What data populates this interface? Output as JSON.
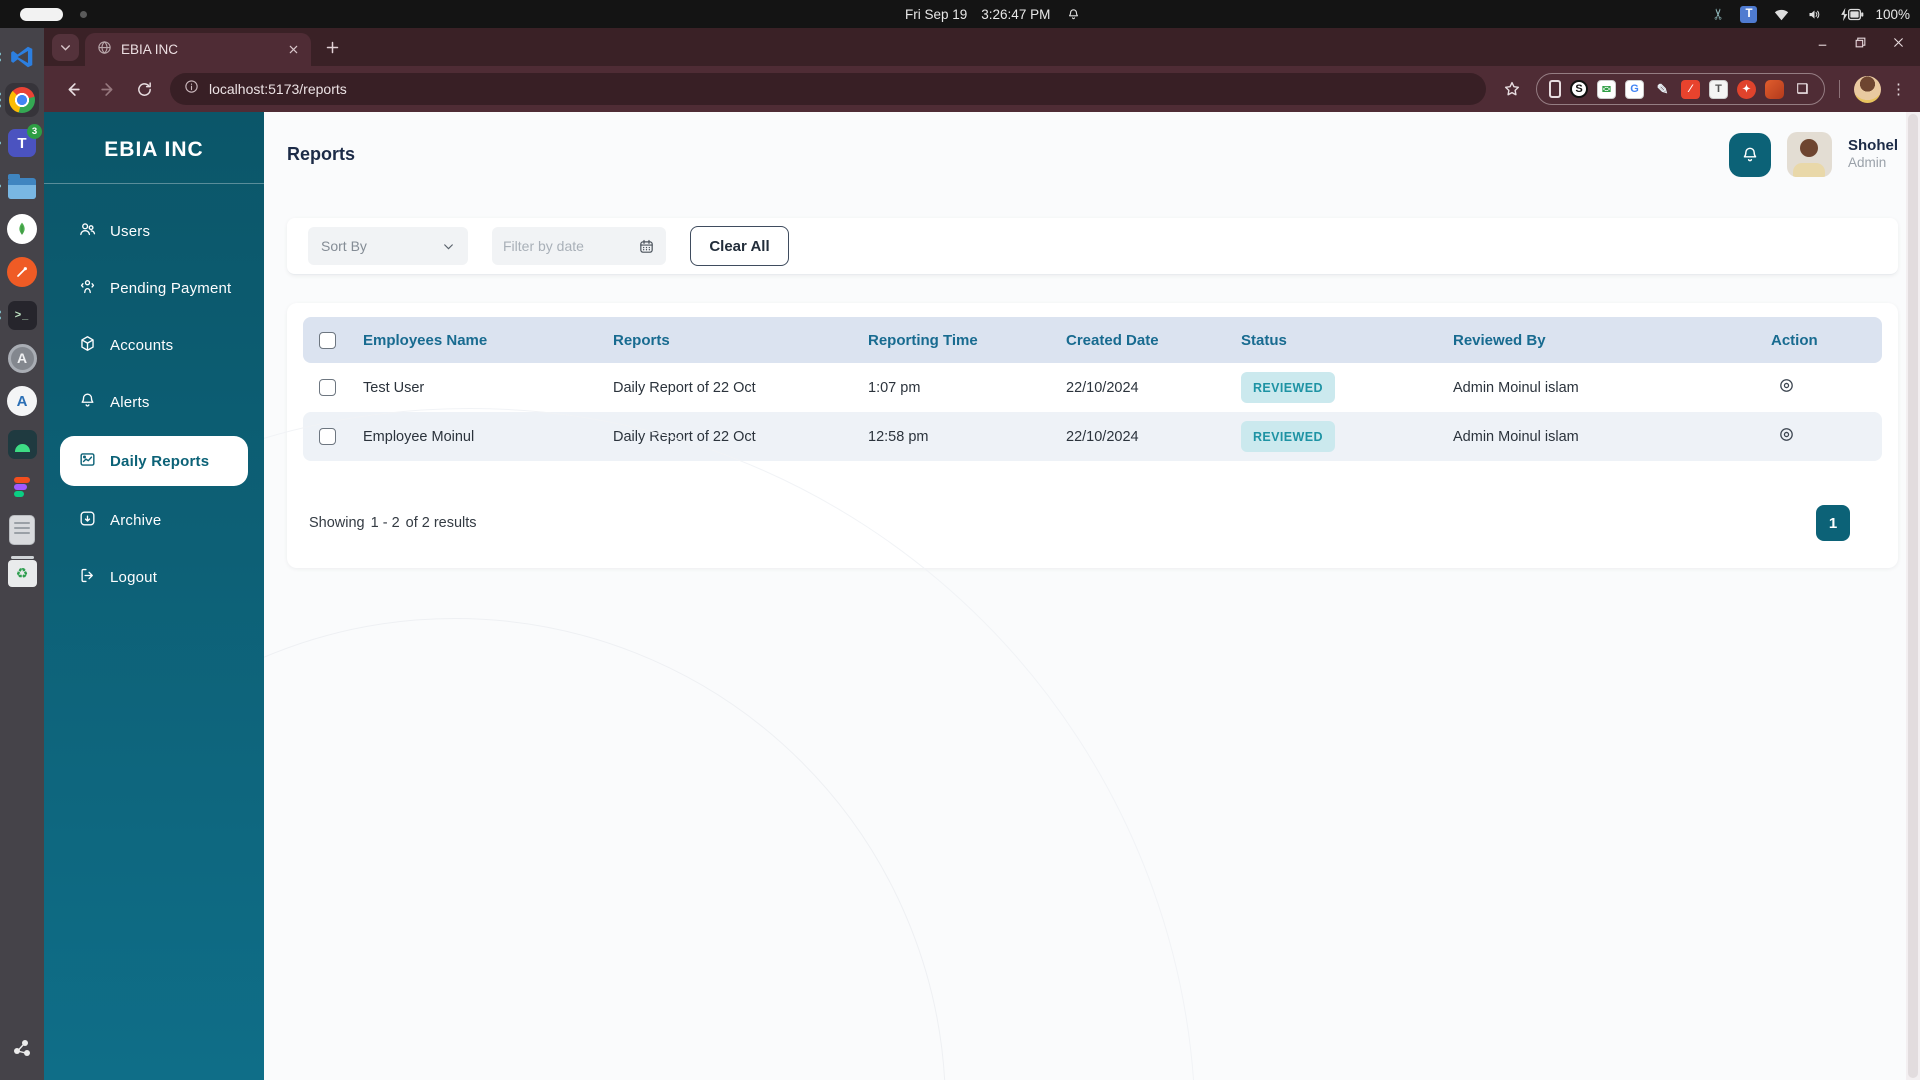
{
  "system_bar": {
    "date": "Fri Sep 19",
    "time": "3:26:47 PM",
    "battery": "100%"
  },
  "dock": {
    "teams_badge": "3"
  },
  "icons": {
    "tray_ribbon": "✂",
    "ime_letter": "T",
    "trash_recycle": "♻",
    "terminal_prompt": ">_"
  },
  "browser": {
    "tab_title": "EBIA INC",
    "url": "localhost:5173/reports"
  },
  "app": {
    "sidebar": {
      "brand": "EBIA INC",
      "items": [
        {
          "label": "Users"
        },
        {
          "label": "Pending Payment"
        },
        {
          "label": "Accounts"
        },
        {
          "label": "Alerts"
        },
        {
          "label": "Daily Reports",
          "active": true
        },
        {
          "label": "Archive"
        },
        {
          "label": "Logout"
        }
      ]
    },
    "header": {
      "title": "Reports",
      "user": {
        "name": "Shohel",
        "role": "Admin"
      }
    },
    "filters": {
      "sort_label": "Sort By",
      "date_placeholder": "Filter by date",
      "clear_label": "Clear All"
    },
    "table": {
      "headers": [
        "Employees Name",
        "Reports",
        "Reporting Time",
        "Created Date",
        "Status",
        "Reviewed By",
        "Action"
      ],
      "rows": [
        {
          "name": "Test User",
          "report": "Daily Report of 22 Oct",
          "time": "1:07 pm",
          "date": "22/10/2024",
          "status": "REVIEWED",
          "reviewed_by": "Admin Moinul islam"
        },
        {
          "name": "Employee Moinul",
          "report": "Daily Report of 22 Oct",
          "time": "12:58 pm",
          "date": "22/10/2024",
          "status": "REVIEWED",
          "reviewed_by": "Admin Moinul islam"
        }
      ]
    },
    "footer": {
      "summary_prefix": "Showing",
      "summary_range": "1 - 2",
      "summary_suffix": "of 2 results",
      "page": "1"
    }
  },
  "colors": {
    "accent_teal": "#0c6277",
    "table_header_bg": "#dbe3f0",
    "table_header_text": "#186b90",
    "badge_bg": "#cbe9ee",
    "badge_text": "#1e93a4",
    "chrome_theme": "#4f2c35"
  }
}
